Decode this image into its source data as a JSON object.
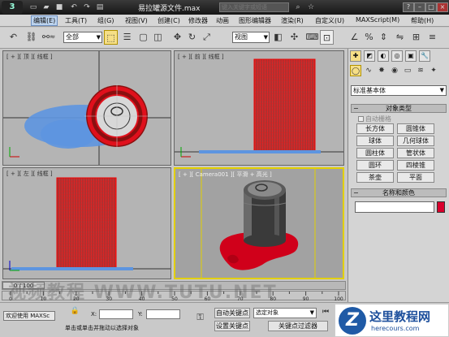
{
  "titlebar": {
    "logo": "3",
    "title": "易拉罐源文件.max",
    "search_placeholder": "键入关键字或短语",
    "icons": [
      "new-file-icon",
      "open-icon",
      "save-icon",
      "undo-icon",
      "redo-icon"
    ],
    "window_buttons": [
      "?",
      "–",
      "□",
      "×"
    ]
  },
  "menu": [
    "编辑(E)",
    "工具(T)",
    "组(G)",
    "视图(V)",
    "创建(C)",
    "修改器",
    "动画",
    "图形编辑器",
    "渲染(R)",
    "自定义(U)",
    "MAXScript(M)",
    "帮助(H)"
  ],
  "toolbar": {
    "selection_filter": "全部",
    "ref_coord": "视图"
  },
  "viewports": {
    "top": "[ + ][ 顶 ][ 线框 ]",
    "front": "[ + ][ 前 ][ 线框 ]",
    "left": "[ + ][ 左 ][ 线框 ]",
    "camera": "[ + ][ Camera001 ][ 平滑 + 高光 ]"
  },
  "command_panel": {
    "tabs": [
      "✚",
      "◩",
      "◐",
      "◎",
      "▣",
      "🔧"
    ],
    "category": "标准基本体",
    "object_type_title": "对象类型",
    "autogrid": "自动栅格",
    "buttons": [
      "长方体",
      "圆锥体",
      "球体",
      "几何球体",
      "圆柱体",
      "管状体",
      "圆环",
      "四棱锥",
      "茶壶",
      "平面"
    ],
    "name_color_title": "名称和颜色",
    "name_value": "",
    "object_color": "#d9002c"
  },
  "timeline": {
    "frame_display": "0 / 100",
    "ticks": [
      "0",
      "10",
      "20",
      "30",
      "40",
      "50",
      "60",
      "70",
      "80",
      "90",
      "100"
    ]
  },
  "status": {
    "welcome": "欢迎使用 MAXSc",
    "prompt": "单击或单击并拖动以选择对象",
    "x_label": "X:",
    "y_label": "Y:",
    "x_value": "",
    "y_value": "",
    "auto_key": "自动关键点",
    "set_key": "设置关键点",
    "selected_dropdown": "选定对象",
    "key_filters": "关键点过滤器"
  },
  "watermark": "视频教程 WWW.TUTU.NET",
  "site_logo": {
    "mark": "Z",
    "title": "这里教程网",
    "url": "herecours.com"
  }
}
